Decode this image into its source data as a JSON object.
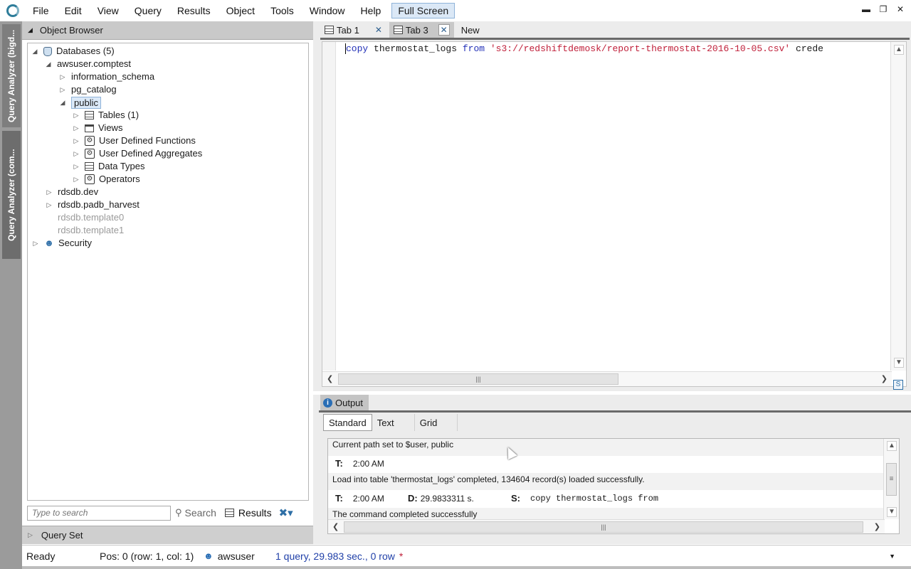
{
  "menu": {
    "items": [
      "File",
      "Edit",
      "View",
      "Query",
      "Results",
      "Object",
      "Tools",
      "Window",
      "Help"
    ],
    "full_screen": "Full Screen"
  },
  "side_tabs": [
    "Query Analyzer (bigd...",
    "Query Analyzer (com..."
  ],
  "object_browser": {
    "title": "Object Browser",
    "tree": [
      {
        "label": "Databases (5)",
        "icon": "database-icon"
      },
      {
        "label": "awsuser.comptest"
      },
      {
        "label": "information_schema"
      },
      {
        "label": "pg_catalog"
      },
      {
        "label": "public"
      },
      {
        "label": "Tables (1)",
        "icon": "table-icon"
      },
      {
        "label": "Views",
        "icon": "view-icon"
      },
      {
        "label": "User Defined Functions",
        "icon": "gear-icon"
      },
      {
        "label": "User Defined Aggregates",
        "icon": "gear-icon"
      },
      {
        "label": "Data Types",
        "icon": "table-icon"
      },
      {
        "label": "Operators",
        "icon": "gear-icon"
      },
      {
        "label": "rdsdb.dev"
      },
      {
        "label": "rdsdb.padb_harvest"
      },
      {
        "label": "rdsdb.template0"
      },
      {
        "label": "rdsdb.template1"
      },
      {
        "label": "Security",
        "icon": "users-icon"
      }
    ],
    "search_placeholder": "Type to search",
    "search_label": "Search",
    "results_label": "Results",
    "query_set_label": "Query Set"
  },
  "editor": {
    "tabs": [
      "Tab 1",
      "Tab 3"
    ],
    "new_tab_label": "New",
    "code": {
      "kw_copy": "copy",
      "table": " thermostat_logs ",
      "kw_from": "from",
      "path": " 's3://redshiftdemosk/report-thermostat-2016-10-05.csv'",
      "rest": " crede"
    }
  },
  "output": {
    "tab_label": "Output",
    "subtabs": [
      "Standard",
      "Text",
      "Grid"
    ],
    "messages": {
      "m1": "Current path set to $user, public",
      "t_label": "T:",
      "time1": "2:00 AM",
      "m2": "Load into table 'thermostat_logs' completed, 134604 record(s) loaded successfully.",
      "time2": "2:00 AM",
      "d_label": "D:",
      "duration": "29.9833311 s.",
      "s_label": "S:",
      "statement": "copy thermostat_logs from",
      "m3": "The command completed successfully"
    }
  },
  "status": {
    "ready": "Ready",
    "position": "Pos: 0 (row: 1, col: 1)",
    "user": "awsuser",
    "query_info": "1 query, 29.983 sec., 0 row",
    "modified_marker": "*"
  },
  "colors": {
    "keyword": "#2432b8",
    "string": "#c0203a",
    "status_info": "#1f3fa8"
  }
}
